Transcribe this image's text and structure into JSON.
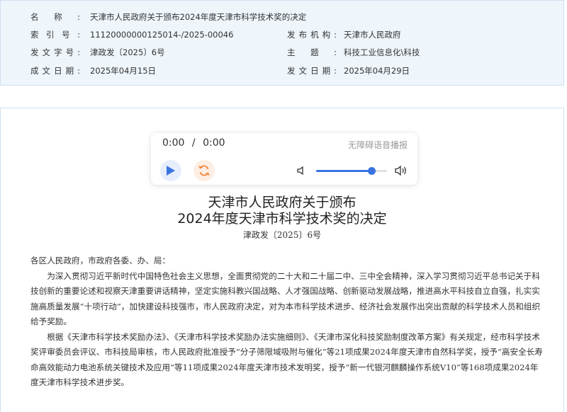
{
  "meta": {
    "rows": [
      {
        "label1": "名称",
        "value1": "天津市人民政府关于颁布2024年度天津市科学技术奖的决定",
        "label2": "",
        "value2": ""
      },
      {
        "label1": "索引号",
        "value1": "11120000000125014-/2025-00046",
        "label2": "发布机构",
        "value2": "天津市人民政府"
      },
      {
        "label1": "发文字号",
        "value1": "津政发〔2025〕6号",
        "label2": "主题",
        "value2": "科技工业信息化\\科技"
      },
      {
        "label1": "成文日期",
        "value1": "2025年04月15日",
        "label2": "发文日期",
        "value2": "2025年04月29日"
      }
    ]
  },
  "player": {
    "current_time": "0:00",
    "separator": "/",
    "duration": "0:00",
    "accessibility_label": "无障碍语音播报",
    "volume": 0.78,
    "accent_color": "#3b74e0",
    "loop_color": "#f08a3c",
    "icons": {
      "play": "play-icon",
      "loop": "loop-icon",
      "vol_low": "volume-low-icon",
      "vol_high": "volume-high-icon"
    }
  },
  "article": {
    "title_line1": "天津市人民政府关于颁布",
    "title_line2": "2024年度天津市科学技术奖的决定",
    "doc_number": "津政发〔2025〕6号",
    "salutation": "各区人民政府，市政府各委、办、局：",
    "paragraph1": "为深入贯彻习近平新时代中国特色社会主义思想，全面贯彻党的二十大和二十届二中、三中全会精神，深入学习贯彻习近平总书记关于科技创新的重要论述和视察天津重要讲话精神，坚定实施科教兴国战略、人才强国战略、创新驱动发展战略，推进高水平科技自立自强，扎实实施高质量发展“十项行动”，加快建设科技强市，市人民政府决定，对为本市科学技术进步、经济社会发展作出突出贡献的科学技术人员和组织给予奖励。",
    "paragraph2": "根据《天津市科学技术奖励办法》、《天津市科学技术奖励办法实施细则》、《天津市深化科技奖励制度改革方案》有关规定，经市科学技术奖评审委员会评议、市科技局审核，市人民政府批准授予“分子筛限域吸附与催化”等21项成果2024年度天津市自然科学奖，授予“高安全长寿命高效能动力电池系统关键技术及应用”等11项成果2024年度天津市技术发明奖，授予“新一代银河麒麟操作系统V10”等168项成果2024年度天津市科学技术进步奖。"
  }
}
